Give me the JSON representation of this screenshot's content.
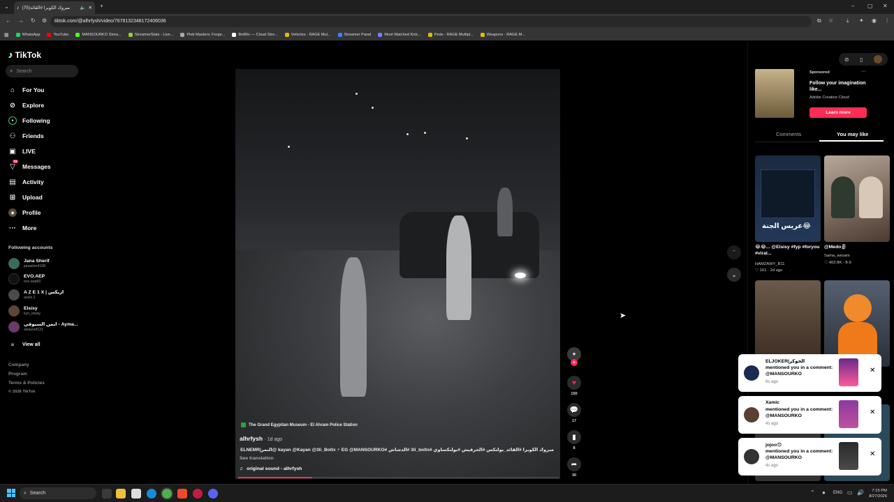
{
  "browser": {
    "tab_title": "مبروك الكوبرا #القائد(75)",
    "url": "tiktok.com/@alhrfysh/video/7678132348172406036",
    "new_tab_label": "+",
    "bookmarks": [
      {
        "label": "WhatsApp",
        "color": "#25d366"
      },
      {
        "label": "YouTube",
        "color": "#ff0000"
      },
      {
        "label": "MANSOURKO Strea...",
        "color": "#53fc18"
      },
      {
        "label": "StreamerStats - Live...",
        "color": "#9acd32"
      },
      {
        "label": "Pleb Masters: Forge...",
        "color": "#aaaaaa"
      },
      {
        "label": "BotRix — Cloud Stre...",
        "color": "#ffffff"
      },
      {
        "label": "Vehicles - RAGE Mul...",
        "color": "#e8b800"
      },
      {
        "label": "Streamer Panel",
        "color": "#3b82f6"
      },
      {
        "label": "Most Watched Kick...",
        "color": "#7c7cff"
      },
      {
        "label": "Peds - RAGE Multipl...",
        "color": "#e8b800"
      },
      {
        "label": "Weapons - RAGE M...",
        "color": "#e8b800"
      }
    ]
  },
  "sidebar": {
    "logo": "TikTok",
    "search_placeholder": "Search",
    "nav": [
      {
        "label": "For You",
        "icon": "home-icon"
      },
      {
        "label": "Explore",
        "icon": "compass-icon"
      },
      {
        "label": "Following",
        "icon": "following-icon"
      },
      {
        "label": "Friends",
        "icon": "friends-icon"
      },
      {
        "label": "LIVE",
        "icon": "live-icon"
      },
      {
        "label": "Messages",
        "icon": "messages-icon",
        "badge": "72"
      },
      {
        "label": "Activity",
        "icon": "activity-icon"
      },
      {
        "label": "Upload",
        "icon": "upload-icon"
      },
      {
        "label": "Profile",
        "icon": "profile-icon"
      },
      {
        "label": "More",
        "icon": "more-icon"
      }
    ],
    "following_title": "Following accounts",
    "accounts": [
      {
        "name": "Jana Sherif",
        "user": "janasherif108"
      },
      {
        "name": "EVO.AEP",
        "user": "evo.aep60"
      },
      {
        "name": "A Z E 1 X | ازيكس",
        "user": "azeix.1"
      },
      {
        "name": "Elsisy",
        "user": "kyn_elsisy"
      },
      {
        "name": "ايمن السيوفي - Ayma...",
        "user": "aisayouf121"
      }
    ],
    "view_all": "View all",
    "footer": [
      "Company",
      "Program",
      "Terms & Policies",
      "© 2026 TikTok"
    ]
  },
  "video": {
    "location": "The Grand Egyptian Museum - El Ahram Police Station",
    "author": "alhrfysh",
    "posted": "· 1d ago",
    "caption": "مبروك الكوبرا #القائد_بولتكس #الحرفيش #بولتكساوي #3li_boltx #الدشاش #kayan @Kayan @3li_Boltx ⚡ EG @MANSOURKO @النمر|ELNEMR 🐆",
    "see_translation": "See translation",
    "sound": "original sound - alhrfysh",
    "likes": "150",
    "comments": "17",
    "saves": "8",
    "shares": "30",
    "progress": 0.23
  },
  "right_panel": {
    "sponsored": {
      "label": "Sponsored",
      "title": "Follow your imagination like...",
      "brand": "Adobe Creative Cloud",
      "cta": "Learn more"
    },
    "tabs": [
      "Comments",
      "You may like"
    ],
    "active_tab": "You may like",
    "cards": [
      {
        "title": "😂😂... @Elsisy #fyp #foryou #viral...",
        "author": "HAMZAWY_B11",
        "stats": "♡ 161 · 2d ago",
        "overlay": "عريس الجنة😂"
      },
      {
        "title": "@Medo🗿",
        "author": "Sama_wesam",
        "stats": "♡ 402.8K · 8-9"
      },
      {
        "title": "",
        "author": "",
        "stats": ""
      },
      {
        "title": "",
        "author": "",
        "stats": ""
      }
    ],
    "notifications": [
      {
        "name": "ELJOKER|الجوكر",
        "message": "mentioned you in a comment: @MANSOURKO",
        "time": "6s ago"
      },
      {
        "name": "Xamic",
        "message": "mentioned you in a comment: @MANSOURKO",
        "time": "4s ago"
      },
      {
        "name": "jojoo😍",
        "message": "mentioned you in a comment: @MANSOURKO",
        "time": "4s ago"
      }
    ]
  },
  "taskbar": {
    "search": "Search",
    "lang": "ENG",
    "time": "7:15 PM",
    "date": "8/27/2026"
  }
}
